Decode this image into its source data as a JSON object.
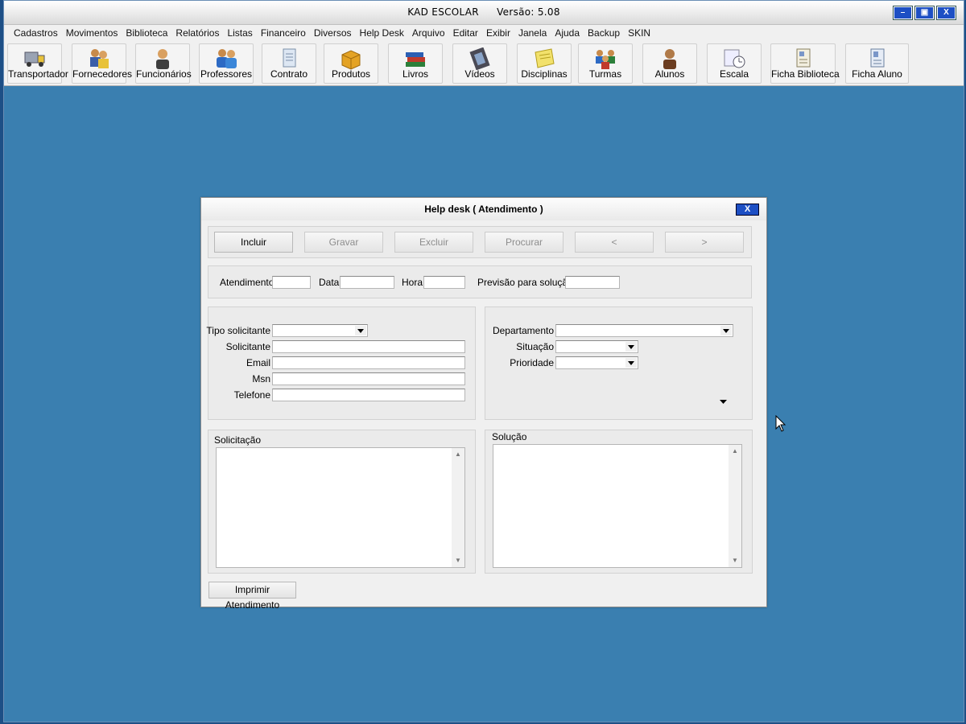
{
  "app": {
    "title": "KAD ESCOLAR",
    "version": "Versão: 5.08",
    "win_minimize": "–",
    "win_maximize": "▣",
    "win_close": "X"
  },
  "menu": [
    "Cadastros",
    "Movimentos",
    "Biblioteca",
    "Relatórios",
    "Listas",
    "Financeiro",
    "Diversos",
    "Help Desk",
    "Arquivo",
    "Editar",
    "Exibir",
    "Janela",
    "Ajuda",
    "Backup",
    "SKIN"
  ],
  "toolbar": [
    "Transportador",
    "Fornecedores",
    "Funcionários",
    "Professores",
    "Contrato",
    "Produtos",
    "Livros",
    "Vídeos",
    "Disciplinas",
    "Turmas",
    "Alunos",
    "Escala",
    "Ficha Biblioteca",
    "Ficha Aluno"
  ],
  "dialog": {
    "title": "Help desk ( Atendimento )",
    "close": "X",
    "buttons": {
      "incluir": "Incluir",
      "gravar": "Gravar",
      "excluir": "Excluir",
      "procurar": "Procurar",
      "prev": "<",
      "next": ">"
    },
    "header_fields": {
      "atendimento": {
        "label": "Atendimento",
        "value": ""
      },
      "data": {
        "label": "Data",
        "value": ""
      },
      "hora": {
        "label": "Hora",
        "value": ""
      },
      "previsao": {
        "label": "Previsão para solução",
        "value": ""
      }
    },
    "requester": {
      "tipo_solicitante": {
        "label": "Tipo solicitante",
        "value": ""
      },
      "solicitante": {
        "label": "Solicitante",
        "value": ""
      },
      "email": {
        "label": "Email",
        "value": ""
      },
      "msn": {
        "label": "Msn",
        "value": ""
      },
      "telefone": {
        "label": "Telefone",
        "value": ""
      }
    },
    "classification": {
      "departamento": {
        "label": "Departamento",
        "value": ""
      },
      "situacao": {
        "label": "Situação",
        "value": ""
      },
      "prioridade": {
        "label": "Prioridade",
        "value": ""
      }
    },
    "solicitacao": {
      "label": "Solicitação",
      "value": ""
    },
    "solucao": {
      "label": "Solução",
      "value": ""
    },
    "print_button": "Imprimir Atendimento"
  }
}
